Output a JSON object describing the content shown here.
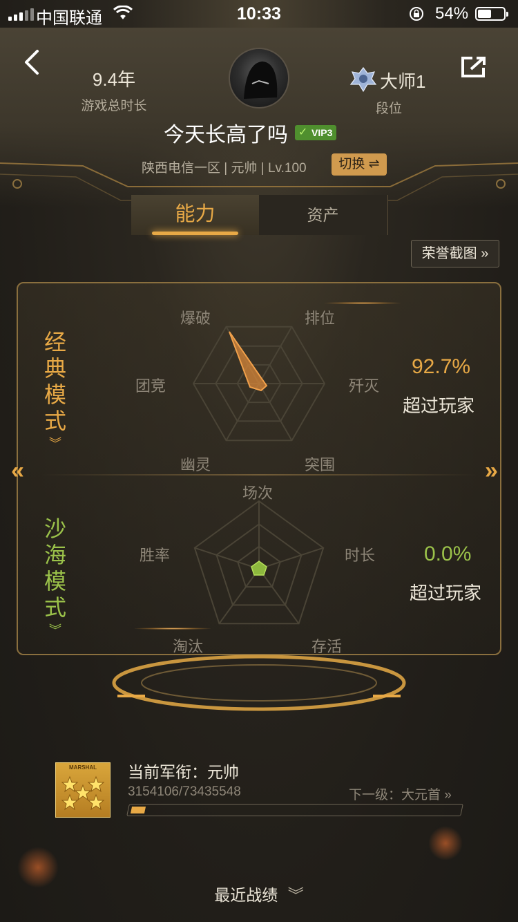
{
  "status_bar": {
    "carrier": "中国联通",
    "time": "10:33",
    "battery_pct": "54%",
    "battery_level": 0.54
  },
  "header": {
    "years": "9.4年",
    "years_label": "游戏总时长",
    "rank_name": "大师1",
    "rank_label": "段位",
    "nickname": "今天长高了吗",
    "vip_badge": "VIP3",
    "server_info": "陕西电信一区 | 元帅 | Lv.100",
    "switch_label": "切换 ⇌"
  },
  "tabs": [
    {
      "label": "能力",
      "active": true
    },
    {
      "label": "资产",
      "active": false
    }
  ],
  "honor_button": "荣誉截图 »",
  "classic_mode": {
    "title_chars": [
      "经",
      "典",
      "模",
      "式"
    ],
    "axes": [
      "爆破",
      "排位",
      "歼灭",
      "突围",
      "幽灵",
      "团竞"
    ],
    "percent": "92.7%",
    "percent_label": "超过玩家",
    "accent": "#e8a946"
  },
  "desert_mode": {
    "title_chars": [
      "沙",
      "海",
      "模",
      "式"
    ],
    "axes": [
      "场次",
      "时长",
      "存活",
      "淘汰",
      "胜率"
    ],
    "percent": "0.0%",
    "percent_label": "超过玩家",
    "accent": "#9bc24a"
  },
  "military_rank": {
    "title": "当前军衔：元帅",
    "badge_text": "MARSHAL",
    "exp": "3154106/73435548",
    "next_level": "下一级：大元首 »",
    "progress": 0.043
  },
  "recent_label": "最近战绩"
}
